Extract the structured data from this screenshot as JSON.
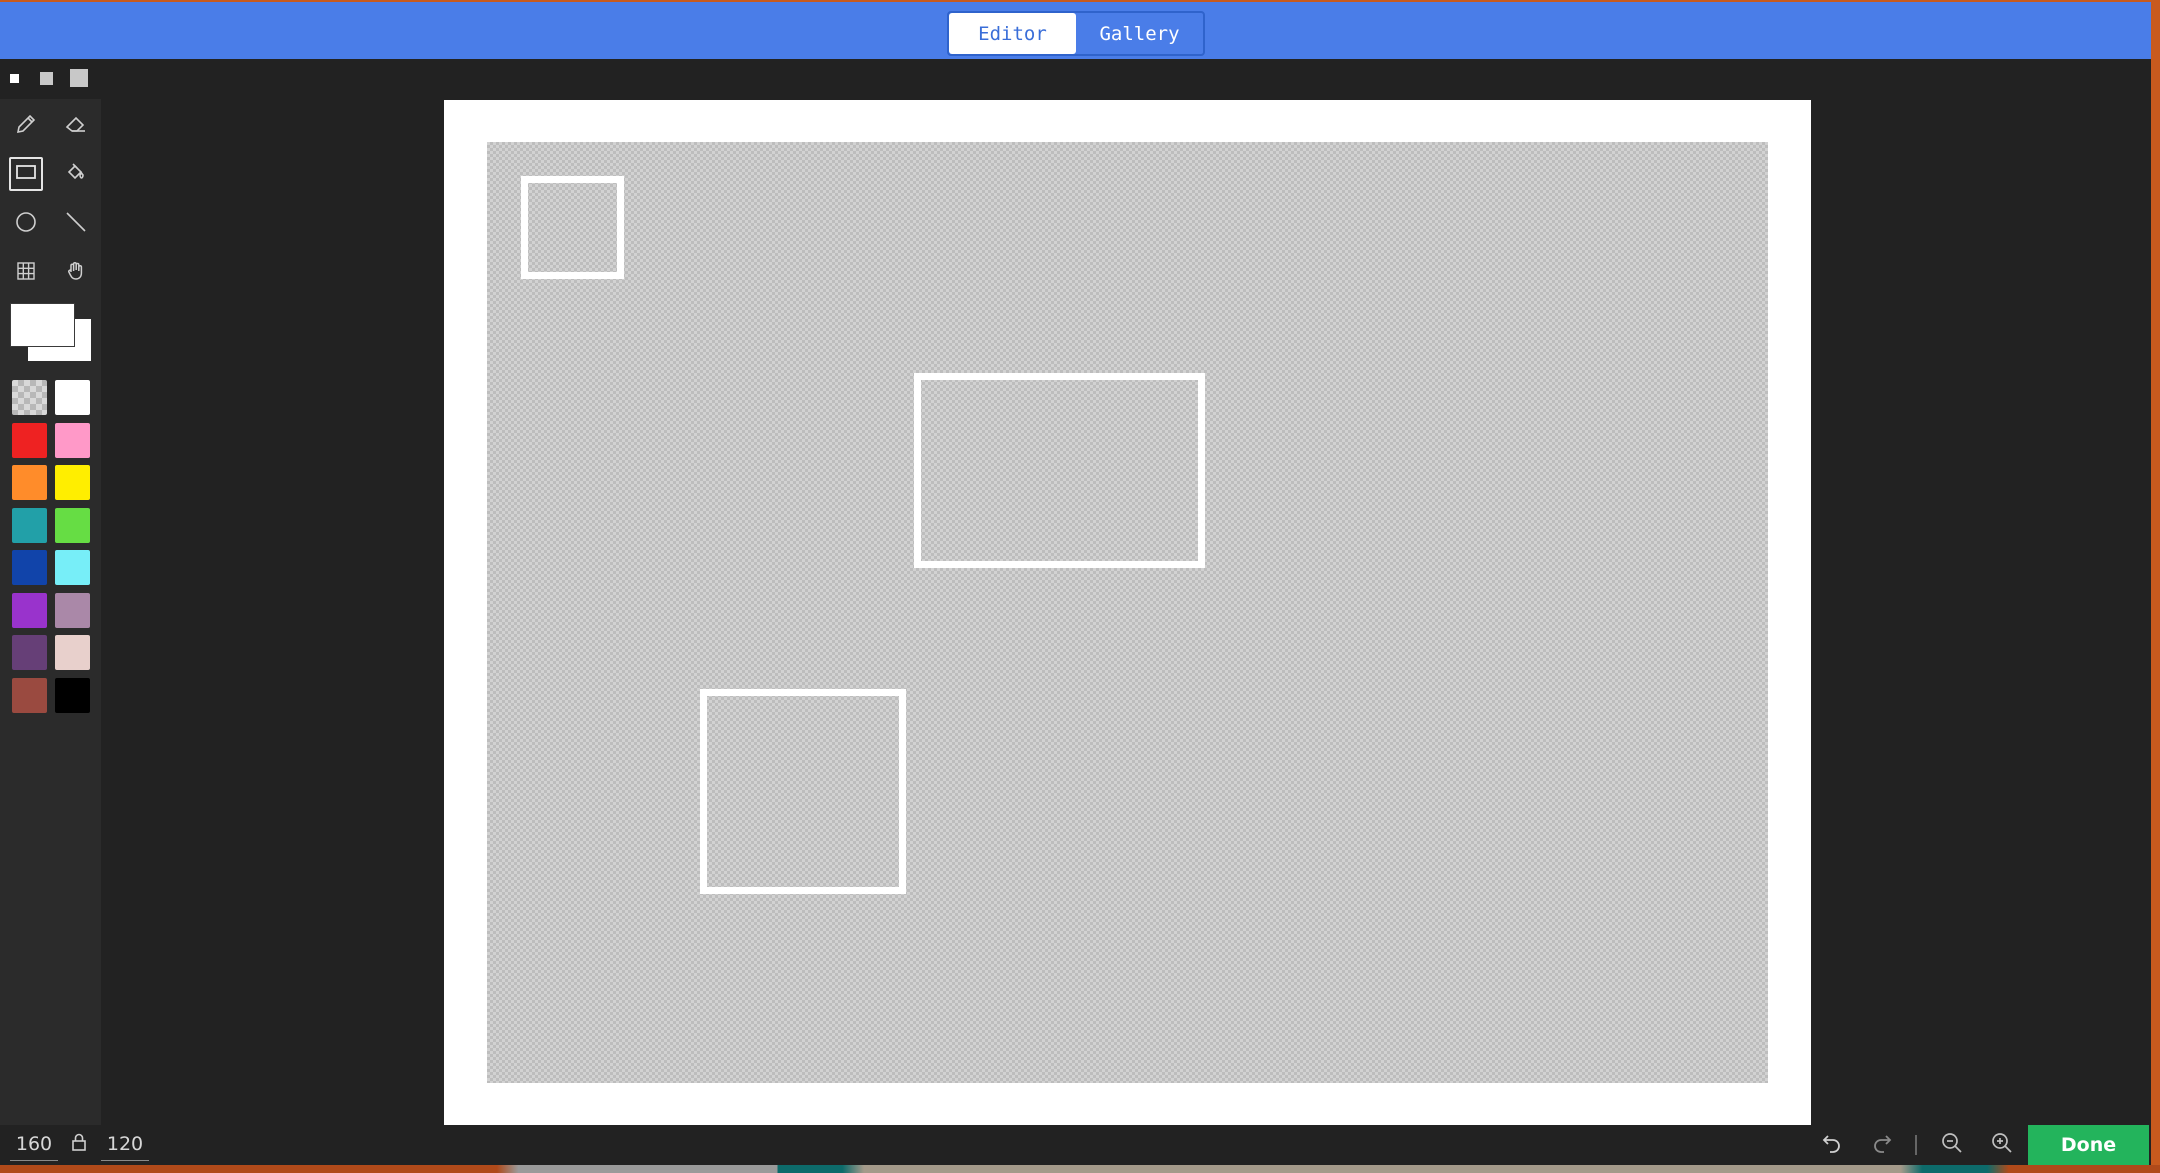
{
  "topbar": {
    "tabs": [
      {
        "label": "Editor",
        "active": true
      },
      {
        "label": "Gallery",
        "active": false
      }
    ]
  },
  "brush_sizes": [
    "small",
    "medium",
    "large"
  ],
  "tools": [
    {
      "name": "pencil-icon"
    },
    {
      "name": "eraser-icon"
    },
    {
      "name": "rectangle-icon",
      "active": true
    },
    {
      "name": "fill-bucket-icon"
    },
    {
      "name": "circle-icon"
    },
    {
      "name": "line-icon"
    },
    {
      "name": "grid-icon"
    },
    {
      "name": "hand-icon"
    }
  ],
  "colors": {
    "foreground": "#ffffff",
    "background": "#ffffff",
    "palette": [
      "transparent",
      "#ffffff",
      "#ee2222",
      "#ff99c8",
      "#ff8c2a",
      "#ffee00",
      "#22a0a8",
      "#66dd44",
      "#1144aa",
      "#77eef8",
      "#9933cc",
      "#aa88a8",
      "#663f77",
      "#e8d0cc",
      "#9a4a40",
      "#000000"
    ]
  },
  "canvas": {
    "width": "160",
    "height": "120"
  },
  "actions": {
    "done_label": "Done"
  }
}
